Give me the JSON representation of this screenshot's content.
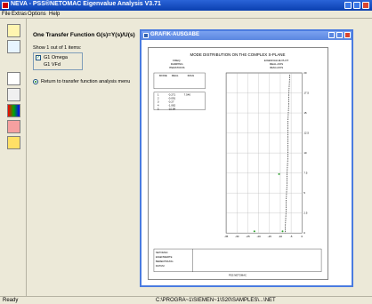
{
  "window": {
    "title": "NEVA - PSS®NETOMAC Eigenvalue Analysis V3.71"
  },
  "menu": [
    "File",
    "Extras",
    "Options",
    "Help"
  ],
  "toolbar": {
    "tools": [
      "open-folder-icon",
      "export-icon",
      "print-icon",
      "view-icon",
      "color-palette-icon",
      "chart-icon",
      "help-icon"
    ]
  },
  "panel": {
    "title": "One Transfer Function G(s)=Y(s)/U(s)",
    "show_text": "Show 1 out of    1 items:",
    "items": [
      {
        "label": "G1 Omega",
        "checked": true
      },
      {
        "label": "G1 VFd"
      }
    ],
    "return_label": "Return to transfer function analysis menu"
  },
  "graphic_window": {
    "title": "GRAFIK-AUSGABE",
    "plot_title": "MODE DISTRIBUTION ON THE COMPLEX S-PLANE",
    "header_left": [
      "FREQ.",
      "DAMPING",
      "ITERATIONS"
    ],
    "header_right": [
      "EIGENVALUE PLOT",
      "REAL AXIS",
      "IMAG AXIS"
    ],
    "table_headers": [
      "MODE",
      "REAL",
      "IMAG"
    ],
    "table_rows": [
      [
        "1",
        "-0.271",
        "7.540"
      ],
      [
        "2",
        "-0.091",
        ""
      ],
      [
        "3",
        "-0.27",
        ""
      ],
      [
        "4",
        "-1.062",
        ""
      ],
      [
        "5",
        "-10.84",
        ""
      ]
    ],
    "y_ticks": [
      "20",
      "17.5",
      "15",
      "12.5",
      "10",
      "7.5",
      "5",
      "2.5",
      "0"
    ],
    "x_ticks": [
      "-35",
      "-30",
      "-25",
      "-20",
      "-15",
      "-10",
      "-5",
      "0"
    ],
    "footer_lines": [
      "NETOMAC",
      "EIGENWERTE",
      "BERECHNUNG",
      "DATUM"
    ],
    "footer_note": "PSS NETOMAC"
  },
  "status": {
    "left": "Ready",
    "path": "C:\\PROGRA~1\\SIEMEN~1\\S20\\SAMPLES\\...\\NET"
  },
  "colors": {
    "titlebar": "#0a3fb0",
    "graf_titlebar": "#5a86e0",
    "point": "#2ca02c"
  }
}
